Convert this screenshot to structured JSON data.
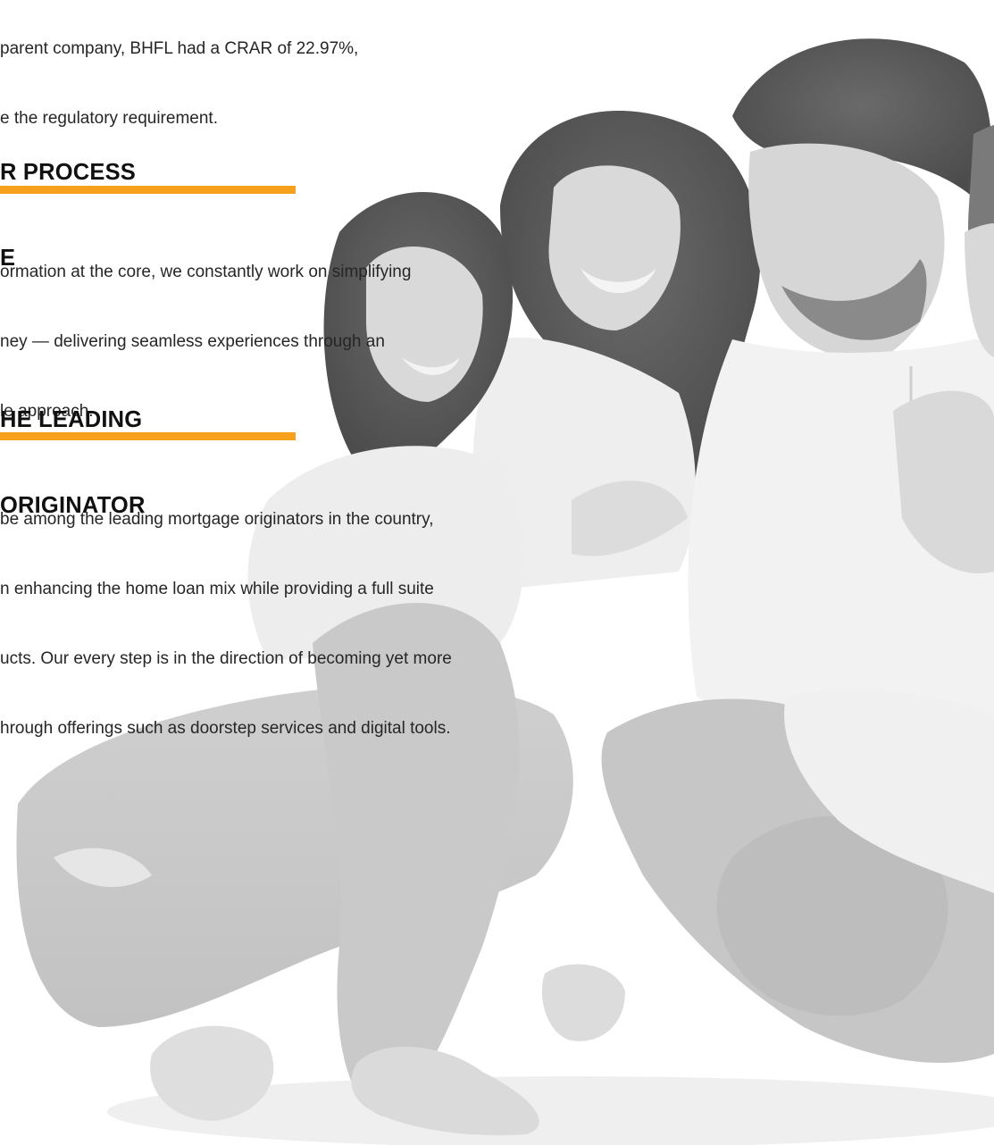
{
  "top_paragraph": {
    "lines": [
      "parent company, BHFL had a CRAR of 22.97%,",
      "e the regulatory requirement."
    ]
  },
  "sections": [
    {
      "heading_lines": [
        "R PROCESS",
        "E"
      ],
      "body_lines": [
        "ormation at the core, we constantly work on simplifying",
        "ney — delivering seamless experiences through an",
        "le approach."
      ]
    },
    {
      "heading_lines": [
        "HE LEADING",
        "ORIGINATOR"
      ],
      "body_lines": [
        "be among the leading mortgage originators in the country,",
        "n enhancing the home loan mix while providing a full suite",
        "ucts. Our every step is in the direction of becoming yet more",
        "hrough offerings such as doorstep services and digital tools."
      ]
    }
  ],
  "colors": {
    "accent_rule": "#f6a01c",
    "photo_tint": "#dcdcdc"
  }
}
